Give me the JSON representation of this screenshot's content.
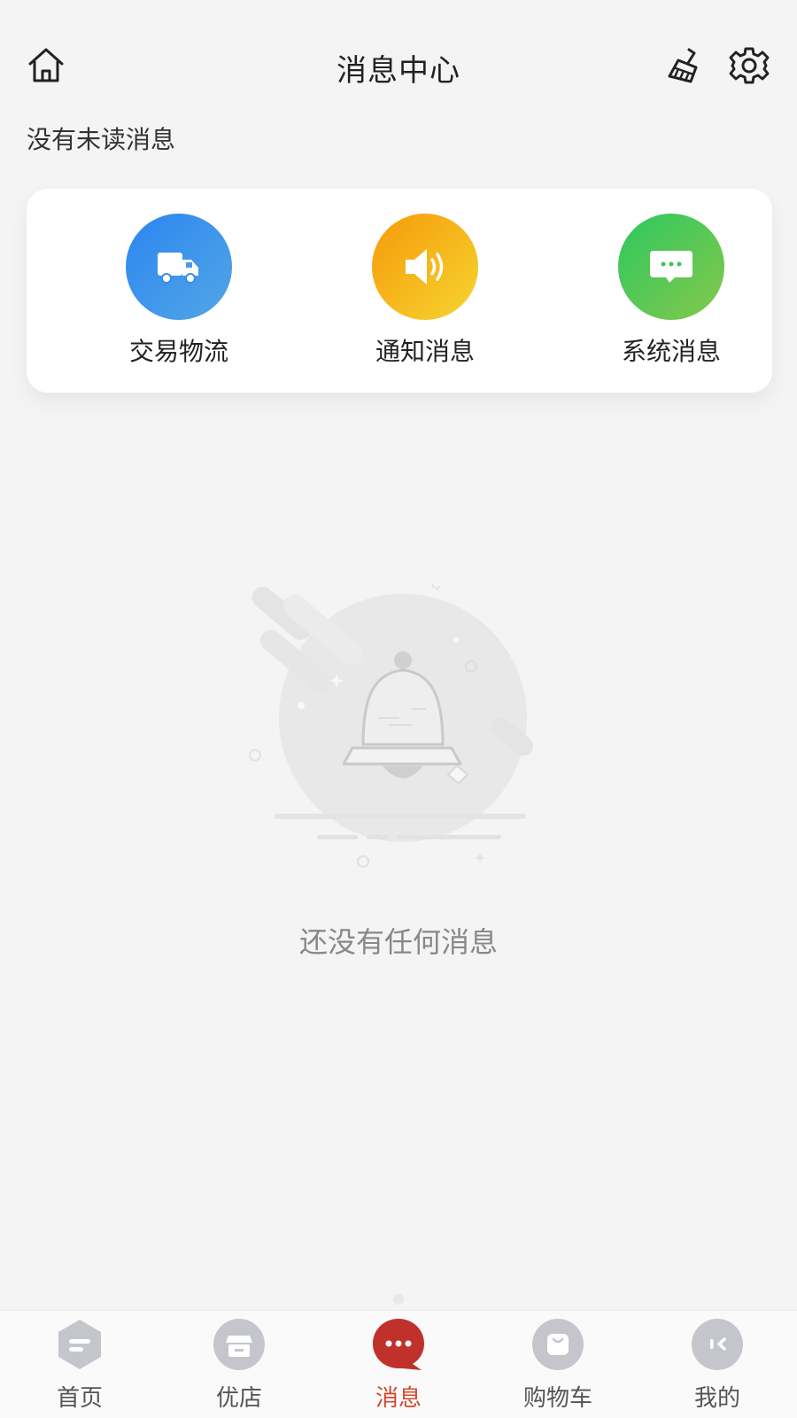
{
  "header": {
    "title": "消息中心",
    "home_icon": "home-icon",
    "clean_icon": "broom-icon",
    "settings_icon": "gear-icon"
  },
  "status": {
    "unread_text": "没有未读消息"
  },
  "categories": [
    {
      "label": "交易物流",
      "icon": "truck-icon",
      "color": "#2a86f0"
    },
    {
      "label": "通知消息",
      "icon": "speaker-icon",
      "color": "#f7a30f"
    },
    {
      "label": "系统消息",
      "icon": "chat-bubble-icon",
      "color": "#3ac85a"
    }
  ],
  "empty_state": {
    "icon": "bell-icon",
    "text": "还没有任何消息"
  },
  "tabbar": {
    "active_color": "#c7312a",
    "items": [
      {
        "label": "首页",
        "icon": "home-tab-icon"
      },
      {
        "label": "优店",
        "icon": "shop-tab-icon"
      },
      {
        "label": "消息",
        "icon": "message-tab-icon",
        "active": true
      },
      {
        "label": "购物车",
        "icon": "cart-tab-icon"
      },
      {
        "label": "我的",
        "icon": "profile-tab-icon"
      }
    ]
  }
}
